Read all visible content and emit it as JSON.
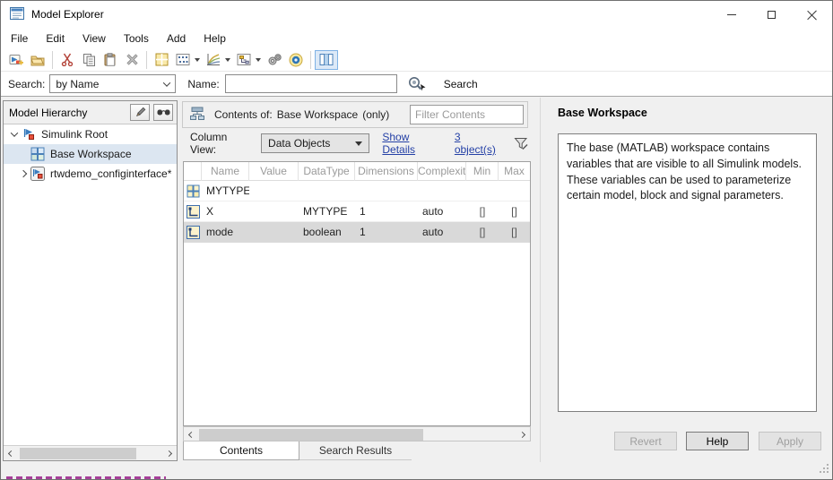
{
  "window": {
    "title": "Model Explorer"
  },
  "menu": {
    "items": [
      "File",
      "Edit",
      "View",
      "Tools",
      "Add",
      "Help"
    ]
  },
  "toolbar": {
    "buttons": [
      "new-model",
      "open",
      "cut",
      "copy",
      "paste",
      "delete",
      "code-window",
      "data-objects",
      "signal-chart",
      "hierarchy-view",
      "settings-gears",
      "configuration-gear",
      "column-view"
    ]
  },
  "search_bar": {
    "search_label": "Search:",
    "search_mode": "by Name",
    "name_label": "Name:",
    "name_value": "",
    "search_button_label": "Search"
  },
  "hierarchy": {
    "title": "Model Hierarchy",
    "items": [
      {
        "label": "Simulink Root",
        "expanded": true
      },
      {
        "label": "Base Workspace",
        "selected": true
      },
      {
        "label": "rtwdemo_configinterface*",
        "collapsed": true
      }
    ]
  },
  "contents": {
    "header": {
      "prefix": "Contents of:",
      "target": "Base Workspace",
      "suffix": "(only)"
    },
    "filter_placeholder": "Filter Contents",
    "column_view_label": "Column View:",
    "column_view_value": "Data Objects",
    "show_details_label": "Show Details",
    "object_count_label": "3 object(s)",
    "table": {
      "columns": [
        "Name",
        "Value",
        "DataType",
        "Dimensions",
        "Complexity",
        "Min",
        "Max"
      ],
      "rows": [
        {
          "icon": "type-table",
          "name": "MYTYPE",
          "value": "",
          "datatype": "",
          "dimensions": "",
          "complexity": "",
          "min": "",
          "max": ""
        },
        {
          "icon": "signal",
          "name": "X",
          "value": "",
          "datatype": "MYTYPE",
          "dimensions": "1",
          "complexity": "auto",
          "min": "[]",
          "max": "[]"
        },
        {
          "icon": "signal",
          "name": "mode",
          "value": "",
          "datatype": "boolean",
          "dimensions": "1",
          "complexity": "auto",
          "min": "[]",
          "max": "[]",
          "highlighted": true
        }
      ]
    },
    "tabs": [
      {
        "label": "Contents",
        "active": true
      },
      {
        "label": "Search Results",
        "active": false
      }
    ]
  },
  "panel": {
    "title": "Base Workspace",
    "description": "The base (MATLAB) workspace contains variables that are visible to all Simulink models. These variables can be used to parameterize certain model, block and signal parameters.",
    "buttons": [
      {
        "label": "Revert",
        "enabled": false
      },
      {
        "label": "Help",
        "enabled": true
      },
      {
        "label": "Apply",
        "enabled": false
      }
    ]
  },
  "colors": {
    "tree_selection_bg": "#dce6f1",
    "row_highlight_bg": "#d9d9d9",
    "link_color": "#2440a6",
    "active_tool_border": "#7fb2e5",
    "active_tool_bg": "#dce9f7"
  }
}
